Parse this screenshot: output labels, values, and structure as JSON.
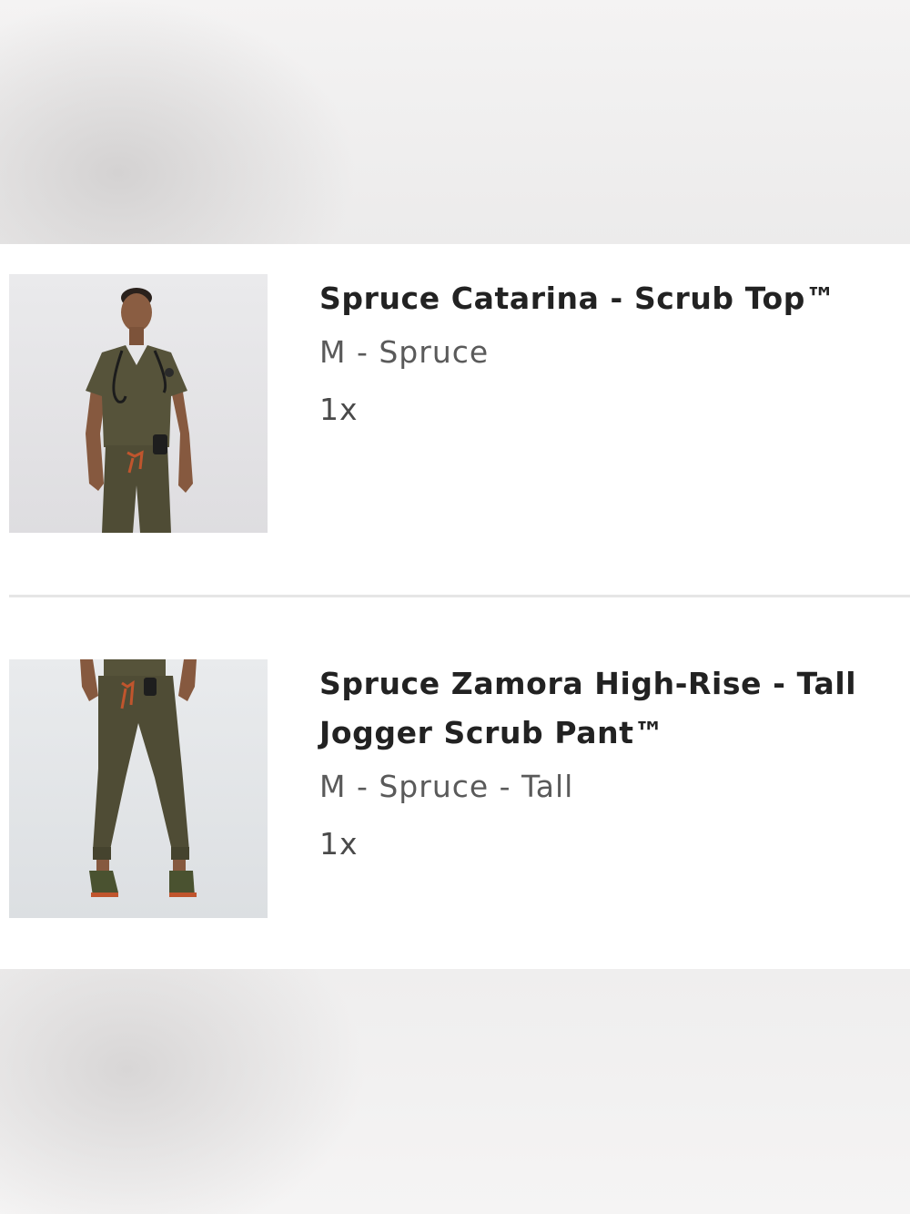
{
  "order_items": [
    {
      "title": "Spruce Catarina - Scrub Top™",
      "variant": "M - Spruce",
      "quantity": "1x",
      "image_icon": "product-photo-scrub-top"
    },
    {
      "title": "Spruce Zamora High-Rise - Tall Jogger Scrub Pant™",
      "variant": "M - Spruce - Tall",
      "quantity": "1x",
      "image_icon": "product-photo-jogger-pant"
    }
  ],
  "colors": {
    "product_olive": "#56533a",
    "drawstring_orange": "#c0552d",
    "title_text": "#222222",
    "muted_text": "#5a5a5a"
  }
}
